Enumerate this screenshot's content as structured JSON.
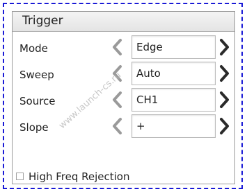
{
  "panel": {
    "title": "Trigger"
  },
  "rows": [
    {
      "label": "Mode",
      "value": "Edge"
    },
    {
      "label": "Sweep",
      "value": "Auto"
    },
    {
      "label": "Source",
      "value": "CH1"
    },
    {
      "label": "Slope",
      "value": "+"
    }
  ],
  "checkbox": {
    "label": "High Freq Rejection",
    "checked": false
  },
  "watermark": "www.launch-cs.ru",
  "colors": {
    "border_dash": "#1a1ad6",
    "arrow_left": "#9a9a9a",
    "arrow_right": "#2a2a2a"
  },
  "icons": {
    "prev": "chevron-left-icon",
    "next": "chevron-right-icon"
  }
}
